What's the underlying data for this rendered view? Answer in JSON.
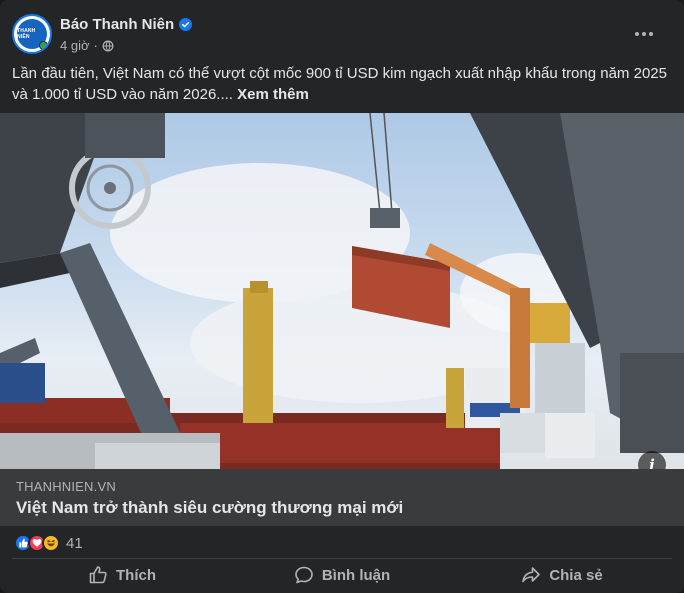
{
  "post": {
    "page_name": "Báo Thanh Niên",
    "avatar_text": "THANH NIÊN",
    "time": "4 giờ",
    "audience_icon": "globe-icon",
    "text": "Lần đầu tiên, Việt Nam có thể vượt cột mốc 900 tỉ USD kim ngạch xuất nhập khẩu trong năm 2025 và 1.000 tỉ USD vào năm 2026....",
    "see_more": "Xem thêm"
  },
  "link_preview": {
    "domain": "THANHNIEN.VN",
    "title": "Việt Nam trở thành siêu cường thương mại mới"
  },
  "reactions": {
    "types": [
      "like-icon",
      "love-icon",
      "haha-icon"
    ],
    "count": "41"
  },
  "actions": {
    "like": "Thích",
    "comment": "Bình luận",
    "share": "Chia sẻ"
  },
  "colors": {
    "card_bg": "#242526",
    "link_bg": "#3a3b3c",
    "brand_blue": "#1877f2",
    "secondary_text": "#b0b3b8"
  }
}
